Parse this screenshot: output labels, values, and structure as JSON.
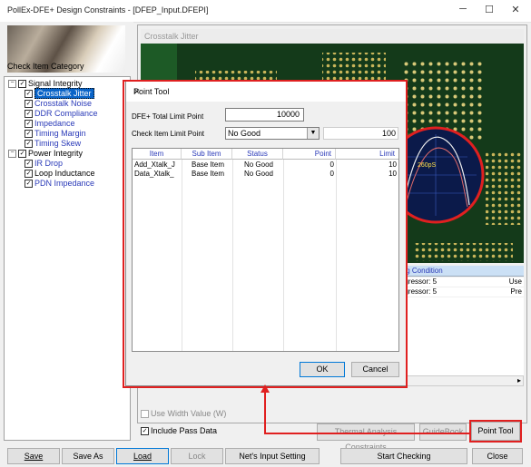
{
  "window": {
    "title": "PollEx-DFE+ Design Constraints - [DFEP_Input.DFEPI]",
    "minimize": "─",
    "maximize": "☐",
    "close": "✕"
  },
  "sidebar": {
    "category_label": "Check Item Category",
    "tree": [
      {
        "label": "Signal Integrity",
        "level": 0,
        "expander": "−"
      },
      {
        "label": "Crosstalk Jitter",
        "level": 1,
        "selected": true
      },
      {
        "label": "Crosstalk Noise",
        "level": 1
      },
      {
        "label": "DDR Compliance",
        "level": 1
      },
      {
        "label": "Impedance",
        "level": 1
      },
      {
        "label": "Timing Margin",
        "level": 1
      },
      {
        "label": "Timing Skew",
        "level": 1
      },
      {
        "label": "Power Integrity",
        "level": 0,
        "expander": "−"
      },
      {
        "label": "IR Drop",
        "level": 1
      },
      {
        "label": "Loop Inductance",
        "level": 1
      },
      {
        "label": "PDN Impedance",
        "level": 1
      }
    ]
  },
  "viewer": {
    "title": "Crosstalk Jitter",
    "scope_label": "260pS",
    "condition_header": "ing Condition",
    "condition_rows": [
      {
        "left": "ggressor: 5",
        "right": "Use"
      },
      {
        "left": "ggressor: 5",
        "right": "Pre"
      }
    ]
  },
  "options": {
    "use_width_value": "Use Width Value (W)",
    "include_pass_data": "Include Pass Data"
  },
  "right_buttons": {
    "thermal": "Thermal Analysis Constraints",
    "guidebook": "GuideBook",
    "point_tool": "Point Tool"
  },
  "bottom_buttons": {
    "save": "Save",
    "save_as": "Save As",
    "load": "Load",
    "lock": "Lock",
    "nets_input": "Net's Input Setting",
    "start_checking": "Start Checking",
    "close": "Close"
  },
  "dialog": {
    "title": "Point Tool",
    "total_limit_label": "DFE+ Total Limit Point",
    "total_limit_value": "10000",
    "check_limit_label": "Check Item Limit Point",
    "check_limit_select": "No Good",
    "check_limit_value": "100",
    "columns": [
      "Item",
      "Sub Item",
      "Status",
      "Point",
      "Limit"
    ],
    "rows": [
      [
        "Add_Xtalk_J",
        "Base Item",
        "No Good",
        "0",
        "10"
      ],
      [
        "Data_Xtalk_",
        "Base Item",
        "No Good",
        "0",
        "10"
      ]
    ],
    "ok": "OK",
    "cancel": "Cancel"
  },
  "colors": {
    "accent_red": "#e02020",
    "link_blue": "#2a3ab8",
    "selection": "#0a64c8",
    "board_green": "#123518"
  }
}
